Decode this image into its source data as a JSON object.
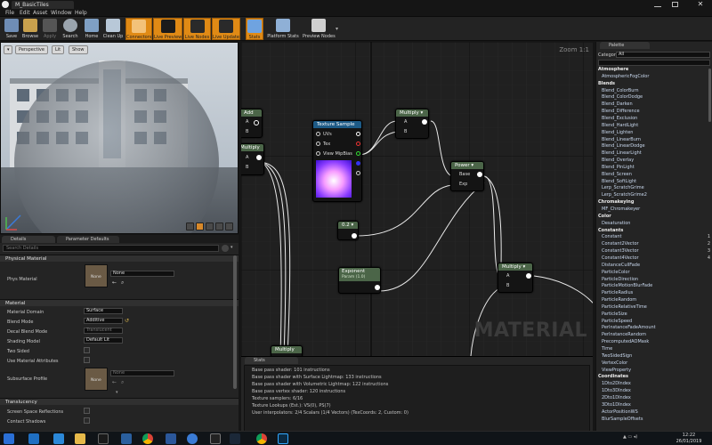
{
  "window": {
    "title": "M_BasicTiles"
  },
  "menu": [
    "File",
    "Edit",
    "Asset",
    "Window",
    "Help"
  ],
  "toolbar": [
    {
      "label": "Save",
      "icon": "save-icon",
      "active": false
    },
    {
      "label": "Browse",
      "icon": "browse-icon",
      "active": false
    },
    {
      "label": "Apply",
      "icon": "apply-icon",
      "active": false
    },
    {
      "label": "Search",
      "icon": "search-icon",
      "active": false
    },
    {
      "label": "Home",
      "icon": "home-icon",
      "active": false
    },
    {
      "label": "Clean Up",
      "icon": "cleanup-icon",
      "active": false
    },
    {
      "label": "Connectors",
      "icon": "connectors-icon",
      "active": true
    },
    {
      "label": "Live Preview",
      "icon": "live-preview-icon",
      "active": true
    },
    {
      "label": "Live Nodes",
      "icon": "live-nodes-icon",
      "active": true
    },
    {
      "label": "Live Update",
      "icon": "live-update-icon",
      "active": true
    },
    {
      "label": "Stats",
      "icon": "stats-icon",
      "active": true
    },
    {
      "label": "Platform Stats",
      "icon": "platform-stats-icon",
      "active": false
    },
    {
      "label": "Preview Nodes",
      "icon": "preview-nodes-icon",
      "active": false
    }
  ],
  "viewport": {
    "perspective": "Perspective",
    "lit": "Lit",
    "show": "Show"
  },
  "details": {
    "tab_details": "Details",
    "tab_params": "Parameter Defaults",
    "search_placeholder": "Search Details",
    "physical_material_header": "Physical Material",
    "phys_material_label": "Phys Material",
    "phys_material_value": "None",
    "thumb_none": "None",
    "material_header": "Material",
    "props": [
      {
        "label": "Material Domain",
        "value": "Surface"
      },
      {
        "label": "Blend Mode",
        "value": "Additive"
      },
      {
        "label": "Decal Blend Mode",
        "value": "Translucent"
      },
      {
        "label": "Shading Model",
        "value": "Default Lit"
      }
    ],
    "two_sided": "Two Sided",
    "use_material_attributes": "Use Material Attributes",
    "subsurface_profile": "Subsurface Profile",
    "subsurface_value": "None",
    "translucency_header": "Translucency",
    "screen_space_reflections": "Screen Space Reflections",
    "contact_shadows": "Contact Shadows"
  },
  "graph": {
    "zoom": "Zoom 1:1",
    "watermark": "MATERIAL",
    "nodes": {
      "add": {
        "title": "Add",
        "pins": [
          "A",
          "B"
        ]
      },
      "multiply_left": {
        "title": "Multiply",
        "pins": [
          "A",
          "B"
        ]
      },
      "texture_sample": {
        "title": "Texture Sample",
        "pins": [
          "UVs",
          "Tex",
          "View MipBias"
        ]
      },
      "multiply_top": {
        "title": "Multiply",
        "pins": [
          "A",
          "B"
        ]
      },
      "power": {
        "title": "Power",
        "pins": [
          "Base",
          "Exp"
        ]
      },
      "const_02": {
        "title": "0.2"
      },
      "exponent": {
        "title": "Exponent",
        "subtitle": "Param (1.0)"
      },
      "multiply_right": {
        "title": "Multiply",
        "pins": [
          "A",
          "B"
        ]
      },
      "multiply_bottom": {
        "title": "Multiply"
      }
    }
  },
  "stats": {
    "tab": "Stats",
    "lines": [
      "Base pass shader: 101 instructions",
      "Base pass shader with Surface Lightmap: 133 instructions",
      "Base pass shader with Volumetric Lightmap: 122 instructions",
      "Base pass vertex shader: 120 instructions",
      "Texture samplers: 6/16",
      "Texture Lookups (Est.): VS(0), PS(7)",
      "User interpolators: 2/4 Scalars (1/4 Vectors) (TexCoords: 2, Custom: 0)"
    ]
  },
  "palette": {
    "tab": "Palette",
    "category_label": "Category",
    "category_value": "All",
    "items": [
      {
        "t": "cat",
        "text": "Atmosphere"
      },
      {
        "t": "item",
        "text": "AtmosphericFogColor"
      },
      {
        "t": "cat",
        "text": "Blends"
      },
      {
        "t": "item",
        "text": "Blend_ColorBurn"
      },
      {
        "t": "item",
        "text": "Blend_ColorDodge"
      },
      {
        "t": "item",
        "text": "Blend_Darken"
      },
      {
        "t": "item",
        "text": "Blend_Difference"
      },
      {
        "t": "item",
        "text": "Blend_Exclusion"
      },
      {
        "t": "item",
        "text": "Blend_HardLight"
      },
      {
        "t": "item",
        "text": "Blend_Lighten"
      },
      {
        "t": "item",
        "text": "Blend_LinearBurn"
      },
      {
        "t": "item",
        "text": "Blend_LinearDodge"
      },
      {
        "t": "item",
        "text": "Blend_LinearLight"
      },
      {
        "t": "item",
        "text": "Blend_Overlay"
      },
      {
        "t": "item",
        "text": "Blend_PinLight"
      },
      {
        "t": "item",
        "text": "Blend_Screen"
      },
      {
        "t": "item",
        "text": "Blend_SoftLight"
      },
      {
        "t": "item",
        "text": "Lerp_ScratchGrime"
      },
      {
        "t": "item",
        "text": "Lerp_ScratchGrime2"
      },
      {
        "t": "cat",
        "text": "Chromakeying"
      },
      {
        "t": "item",
        "text": "MF_Chromakeyer"
      },
      {
        "t": "cat",
        "text": "Color"
      },
      {
        "t": "item",
        "text": "Desaturation"
      },
      {
        "t": "cat",
        "text": "Constants"
      },
      {
        "t": "item",
        "text": "Constant",
        "key": "1"
      },
      {
        "t": "item",
        "text": "Constant2Vector",
        "key": "2"
      },
      {
        "t": "item",
        "text": "Constant3Vector",
        "key": "3"
      },
      {
        "t": "item",
        "text": "Constant4Vector",
        "key": "4"
      },
      {
        "t": "item",
        "text": "DistanceCullFade"
      },
      {
        "t": "item",
        "text": "ParticleColor"
      },
      {
        "t": "item",
        "text": "ParticleDirection"
      },
      {
        "t": "item",
        "text": "ParticleMotionBlurFade"
      },
      {
        "t": "item",
        "text": "ParticleRadius"
      },
      {
        "t": "item",
        "text": "ParticleRandom"
      },
      {
        "t": "item",
        "text": "ParticleRelativeTime"
      },
      {
        "t": "item",
        "text": "ParticleSize"
      },
      {
        "t": "item",
        "text": "ParticleSpeed"
      },
      {
        "t": "item",
        "text": "PerInstanceFadeAmount"
      },
      {
        "t": "item",
        "text": "PerInstanceRandom"
      },
      {
        "t": "item",
        "text": "PrecomputedAOMask"
      },
      {
        "t": "item",
        "text": "Time"
      },
      {
        "t": "item",
        "text": "TwoSidedSign"
      },
      {
        "t": "item",
        "text": "VertexColor"
      },
      {
        "t": "item",
        "text": "ViewProperty"
      },
      {
        "t": "cat",
        "text": "Coordinates"
      },
      {
        "t": "item",
        "text": "1Dto2DIndex"
      },
      {
        "t": "item",
        "text": "1Dto3DIndex"
      },
      {
        "t": "item",
        "text": "2Dto1DIndex"
      },
      {
        "t": "item",
        "text": "3Dto1DIndex"
      },
      {
        "t": "item",
        "text": "ActorPositionWS"
      },
      {
        "t": "item",
        "text": "BlurSampleOffsets"
      }
    ]
  },
  "taskbar": {
    "time": "12:22",
    "date": "26/01/2019"
  }
}
